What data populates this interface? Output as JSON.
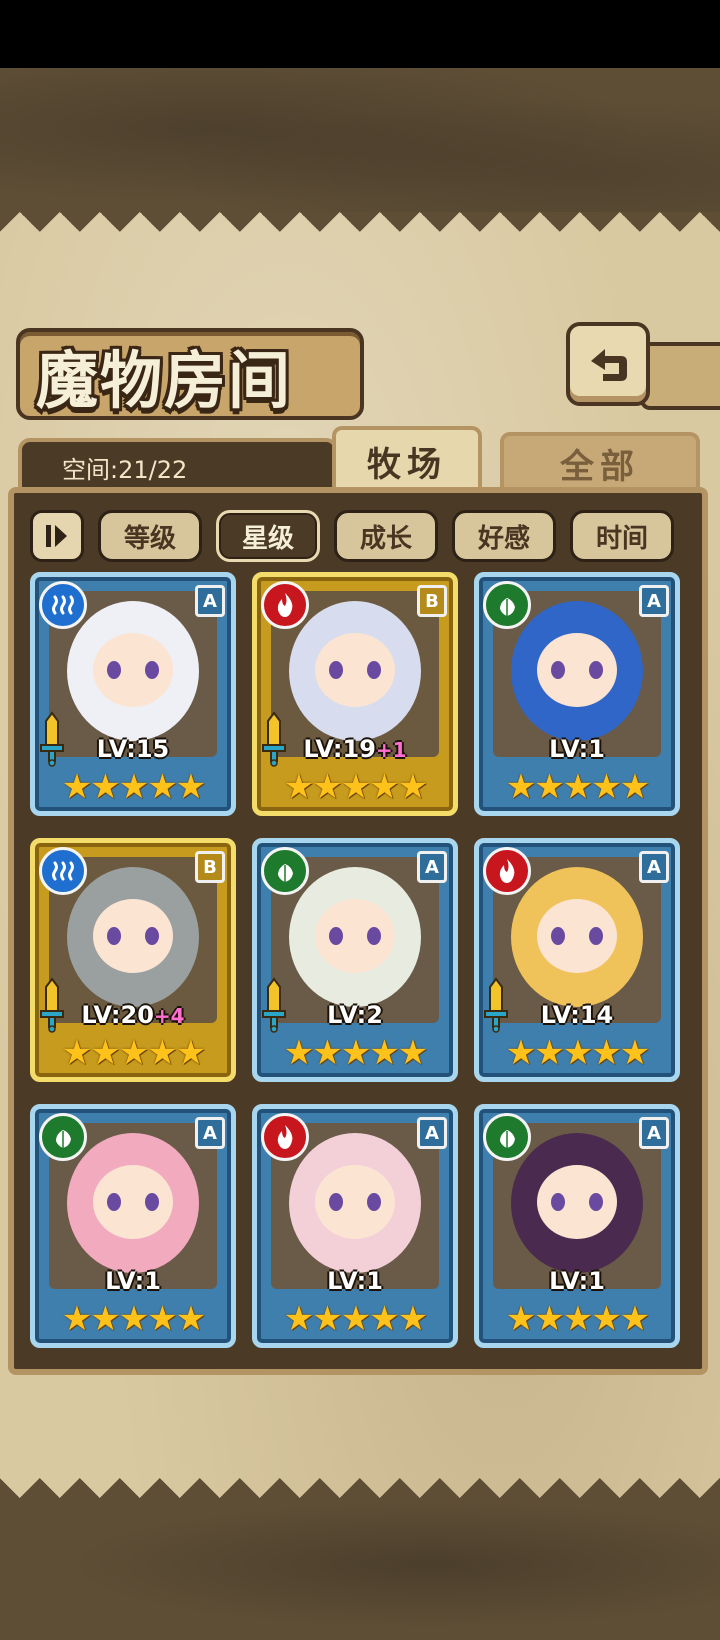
{
  "page": {
    "title": "魔物房间",
    "capacity_label": "空间:21/22",
    "tabs": [
      {
        "label": "牧场",
        "active": true
      },
      {
        "label": "全部",
        "active": false
      }
    ],
    "filters": [
      {
        "label": "等级",
        "active": false
      },
      {
        "label": "星级",
        "active": true
      },
      {
        "label": "成长",
        "active": false
      },
      {
        "label": "好感",
        "active": false
      },
      {
        "label": "时间",
        "active": false
      }
    ]
  },
  "monsters": [
    {
      "element": "water",
      "rank": "A",
      "frame": "blue",
      "level": "LV:15",
      "bonus": "",
      "stars": 5,
      "has_sword": true,
      "hair": "#eef0f6"
    },
    {
      "element": "fire",
      "rank": "B",
      "frame": "gold",
      "level": "LV:19",
      "bonus": "+1",
      "stars": 5,
      "has_sword": true,
      "hair": "#d7dcef"
    },
    {
      "element": "nature",
      "rank": "A",
      "frame": "blue",
      "level": "LV:1",
      "bonus": "",
      "stars": 5,
      "has_sword": false,
      "hair": "#2f66c8"
    },
    {
      "element": "water",
      "rank": "B",
      "frame": "gold",
      "level": "LV:20",
      "bonus": "+4",
      "stars": 5,
      "has_sword": true,
      "hair": "#9aa0a0"
    },
    {
      "element": "nature",
      "rank": "A",
      "frame": "blue",
      "level": "LV:2",
      "bonus": "",
      "stars": 5,
      "has_sword": true,
      "hair": "#e8ece0"
    },
    {
      "element": "fire",
      "rank": "A",
      "frame": "blue",
      "level": "LV:14",
      "bonus": "",
      "stars": 5,
      "has_sword": true,
      "hair": "#f0c35a"
    },
    {
      "element": "nature",
      "rank": "A",
      "frame": "blue",
      "level": "LV:1",
      "bonus": "",
      "stars": 5,
      "has_sword": false,
      "hair": "#f2aabf"
    },
    {
      "element": "fire",
      "rank": "A",
      "frame": "blue",
      "level": "LV:1",
      "bonus": "",
      "stars": 5,
      "has_sword": false,
      "hair": "#f3d0d8"
    },
    {
      "element": "nature",
      "rank": "A",
      "frame": "blue",
      "level": "LV:1",
      "bonus": "",
      "stars": 5,
      "has_sword": false,
      "hair": "#4a2a4e"
    }
  ]
}
